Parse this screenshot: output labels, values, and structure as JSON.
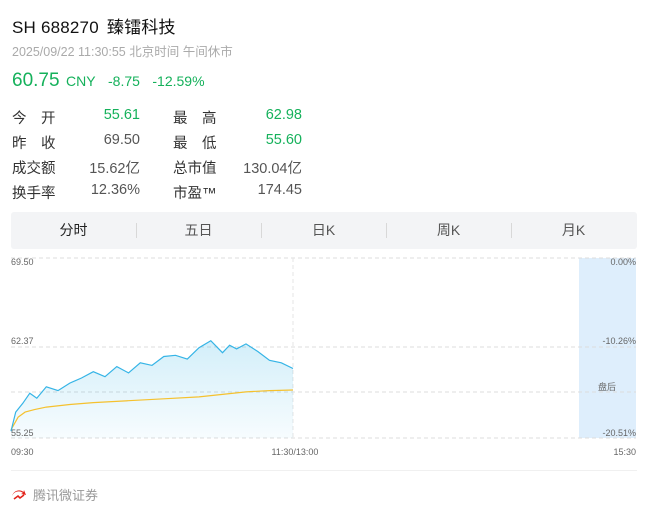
{
  "header": {
    "code": "SH 688270",
    "name": "臻镭科技",
    "subtitle": "2025/09/22 11:30:55 北京时间 午间休市"
  },
  "price": {
    "last": "60.75",
    "currency": "CNY",
    "change": "-8.75",
    "change_pct": "-12.59%"
  },
  "quotes": {
    "open_label": "今　开",
    "open": "55.61",
    "high_label": "最　高",
    "high": "62.98",
    "prev_close_label": "昨　收",
    "prev_close": "69.50",
    "low_label": "最　低",
    "low": "55.60",
    "turnover_label": "成交额",
    "turnover": "15.62亿",
    "mktcap_label": "总市值",
    "mktcap": "130.04亿",
    "turnover_rate_label": "换手率",
    "turnover_rate": "12.36%",
    "pe_label": "市盈™",
    "pe": "174.45"
  },
  "tabs": [
    "分时",
    "五日",
    "日K",
    "周K",
    "月K"
  ],
  "active_tab": 0,
  "colors": {
    "down": "#15b15b",
    "price_line": "#35b4e6",
    "avg_line": "#f5c12e",
    "after_hours_bg": "#deeefc"
  },
  "chart_data": {
    "type": "line",
    "title": "",
    "y_left_ticks": [
      "69.50",
      "62.37",
      "55.25"
    ],
    "y_right_ticks": [
      "0.00%",
      "-10.26%",
      "-20.51%"
    ],
    "x_ticks": [
      "09:30",
      "11:30/13:00",
      "15:30"
    ],
    "ylim": [
      55.25,
      69.5
    ],
    "prev_close": 69.5,
    "after_hours_label": "盘后",
    "series": [
      {
        "key": "price",
        "time": [
          "09:30",
          "09:32",
          "09:35",
          "09:38",
          "09:41",
          "09:45",
          "09:50",
          "09:55",
          "10:00",
          "10:05",
          "10:10",
          "10:15",
          "10:20",
          "10:25",
          "10:30",
          "10:35",
          "10:40",
          "10:45",
          "10:50",
          "10:55",
          "11:00",
          "11:03",
          "11:06",
          "11:10",
          "11:15",
          "11:20",
          "11:25",
          "11:30"
        ],
        "values": [
          55.8,
          57.3,
          58.0,
          58.8,
          58.4,
          59.3,
          59.0,
          59.6,
          60.0,
          60.5,
          60.1,
          60.9,
          60.4,
          61.2,
          61.0,
          61.7,
          61.8,
          61.5,
          62.4,
          62.95,
          62.0,
          62.6,
          62.3,
          62.7,
          62.1,
          61.4,
          61.2,
          60.75
        ]
      },
      {
        "key": "average",
        "time": [
          "09:30",
          "09:33",
          "09:36",
          "09:40",
          "09:45",
          "09:55",
          "10:05",
          "10:20",
          "10:35",
          "10:50",
          "11:00",
          "11:10",
          "11:20",
          "11:30"
        ],
        "values": [
          55.9,
          56.9,
          57.3,
          57.5,
          57.7,
          57.9,
          58.05,
          58.2,
          58.35,
          58.5,
          58.7,
          58.9,
          59.0,
          59.05
        ]
      }
    ]
  },
  "footer": {
    "brand": "腾讯微证券"
  }
}
